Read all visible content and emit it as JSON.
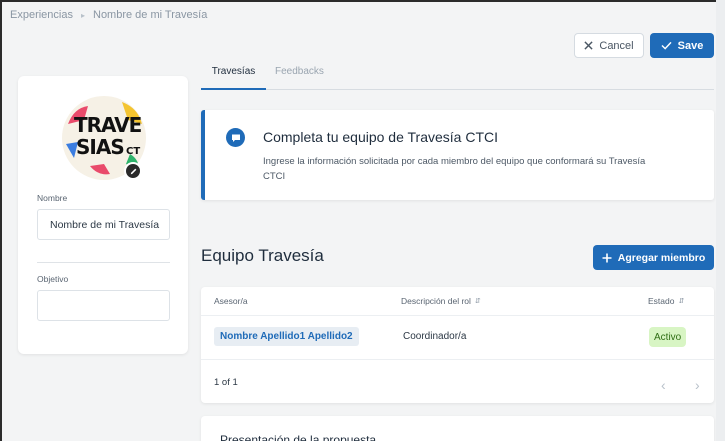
{
  "breadcrumb": {
    "items": [
      "Experiencias",
      "Nombre de mi Travesía"
    ]
  },
  "toolbar": {
    "cancel_label": "Cancel",
    "save_label": "Save"
  },
  "profile": {
    "logo_text": [
      "TRAVE",
      "SIAS",
      "CT"
    ],
    "name_label": "Nombre",
    "name_value": "Nombre de mi Travesía",
    "objective_label": "Objetivo",
    "objective_value": ""
  },
  "tabs": [
    {
      "label": "Travesías",
      "active": true
    },
    {
      "label": "Feedbacks",
      "active": false
    }
  ],
  "alert": {
    "title": "Completa tu equipo de Travesía CTCI",
    "text": "Ingrese la información solicitada por cada miembro del equipo que conformará su Travesía CTCI"
  },
  "team": {
    "title": "Equipo Travesía",
    "add_label": "Agregar miembro",
    "columns": [
      "Asesor/a",
      "Descripción del rol",
      "Estado"
    ],
    "rows": [
      {
        "name": "Nombre Apellido1 Apellido2",
        "role": "Coordinador/a",
        "status": "Activo"
      }
    ],
    "pagination": "1 of 1"
  },
  "proposal": {
    "title": "Presentación de la propuesta"
  },
  "colors": {
    "primary": "#1f6bb8",
    "active_badge_bg": "#d8f5c4",
    "active_badge_text": "#2f6e14"
  }
}
